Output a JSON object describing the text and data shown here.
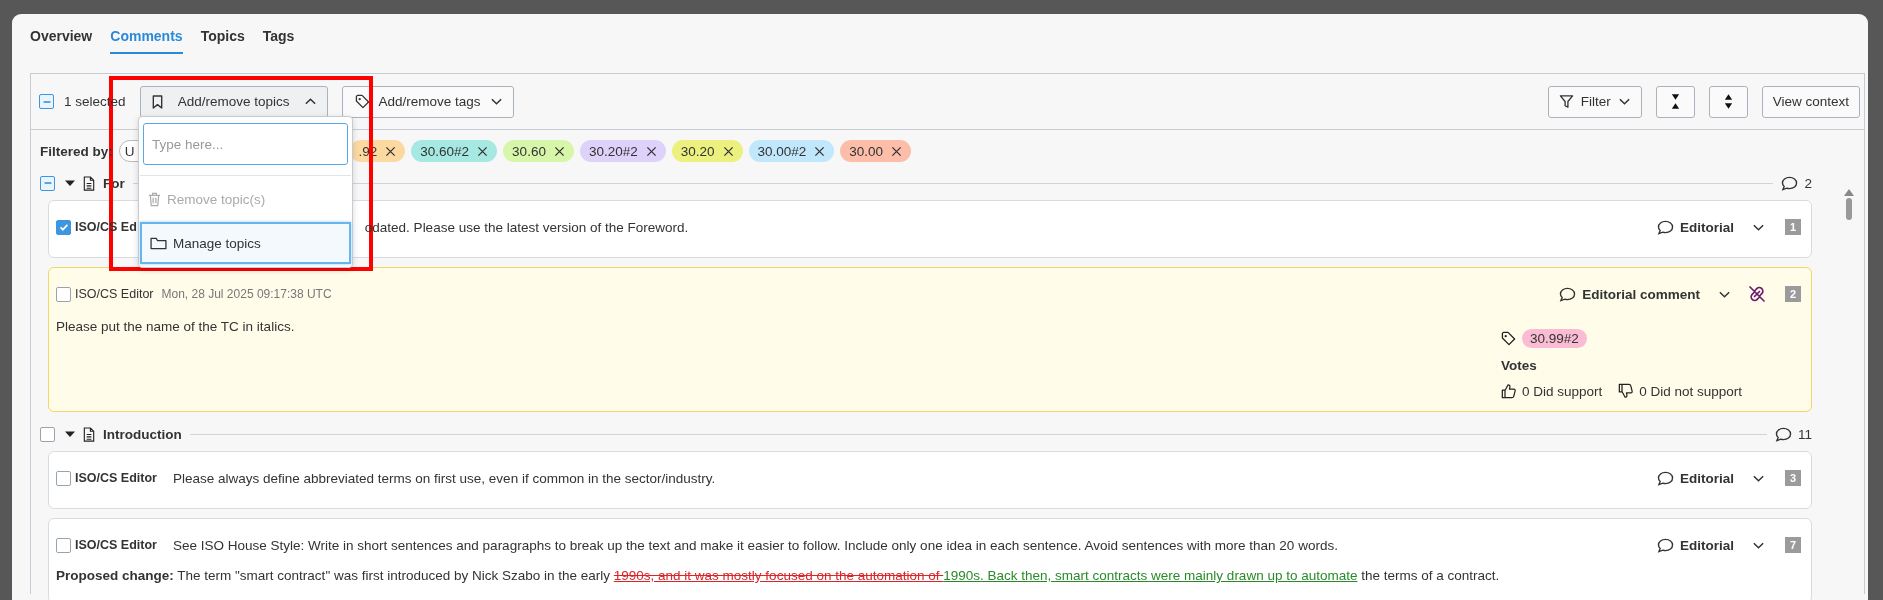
{
  "tabs": [
    {
      "label": "Overview",
      "selected": false
    },
    {
      "label": "Comments",
      "selected": true
    },
    {
      "label": "Topics",
      "selected": false
    },
    {
      "label": "Tags",
      "selected": false
    }
  ],
  "toolbar": {
    "select_all": {
      "indeterminate": true
    },
    "selection_label": "1 selected",
    "topics_button": {
      "label": "Add/remove topics",
      "expanded": true
    },
    "tags_button": {
      "label": "Add/remove tags",
      "expanded": false
    },
    "filter_button": {
      "label": "Filter",
      "expanded": false
    },
    "view_context_button": {
      "label": "View context"
    }
  },
  "topics_menu": {
    "placeholder": "Type here...",
    "items": [
      {
        "kind": "remove",
        "label": "Remove topic(s)",
        "disabled": true,
        "selected": false
      },
      {
        "kind": "manage",
        "label": "Manage topics",
        "disabled": false,
        "selected": true
      }
    ]
  },
  "filters": {
    "label": "Filtered by:",
    "chips": [
      {
        "label": "U",
        "color": "#ffffff",
        "removable": false
      },
      {
        "label": ".92",
        "color": "#fdd9a2",
        "removable": true
      },
      {
        "label": "30.60#2",
        "color": "#a6e9e2",
        "removable": true
      },
      {
        "label": "30.60",
        "color": "#d7f6aa",
        "removable": true
      },
      {
        "label": "30.20#2",
        "color": "#ded2fb",
        "removable": true
      },
      {
        "label": "30.20",
        "color": "#ebf07e",
        "removable": true
      },
      {
        "label": "30.00#2",
        "color": "#c0e7fc",
        "removable": true
      },
      {
        "label": "30.00",
        "color": "#fcbea9",
        "removable": true
      }
    ]
  },
  "sections": [
    {
      "title": "For",
      "indeterminate": true,
      "expanded": true,
      "count": "2",
      "comments": [
        {
          "author": "ISO/CS Ed",
          "text": "odated. Please use the latest version of the Foreword.",
          "category": "Editorial",
          "number": "1",
          "checked": true,
          "highlighted": false
        },
        {
          "author": "ISO/CS Editor",
          "date": "Mon, 28 Jul 2025 09:17:38 UTC",
          "text": "Please put the name of the TC in italics.",
          "category": "Editorial comment",
          "number": "2",
          "checked": false,
          "highlighted": true,
          "unlinked": true,
          "tags": [
            {
              "label": "30.99#2",
              "color": "#f9bcd2"
            }
          ],
          "votes": {
            "title": "Votes",
            "support": "0 Did support",
            "oppose": "0 Did not support"
          }
        }
      ]
    },
    {
      "title": "Introduction",
      "checked": false,
      "indeterminate": false,
      "expanded": true,
      "count": "11",
      "comments": [
        {
          "author": "ISO/CS Editor",
          "text": "Please always define abbreviated terms on first use, even if common in the sector/industry.",
          "category": "Editorial",
          "number": "3",
          "checked": false,
          "highlighted": false
        },
        {
          "author": "ISO/CS Editor",
          "text": "See ISO House Style: Write in short sentences and paragraphs to break up the text and make it easier to follow. Include only one idea in each sentence. Avoid sentences with more than 20 words.",
          "category": "Editorial",
          "number": "7",
          "checked": false,
          "highlighted": false,
          "proposed_change": {
            "label": "Proposed change:",
            "segments": [
              {
                "kind": "plain",
                "text": "The term \"smart contract\" was first introduced by Nick Szabo in the early "
              },
              {
                "kind": "deleted",
                "text": "1990s, and it was mostly focused on the automation of "
              },
              {
                "kind": "inserted",
                "text": "1990s. Back then, smart contracts were mainly drawn up to automate"
              },
              {
                "kind": "plain",
                "text": " the terms of a contract."
              }
            ]
          }
        }
      ]
    }
  ]
}
